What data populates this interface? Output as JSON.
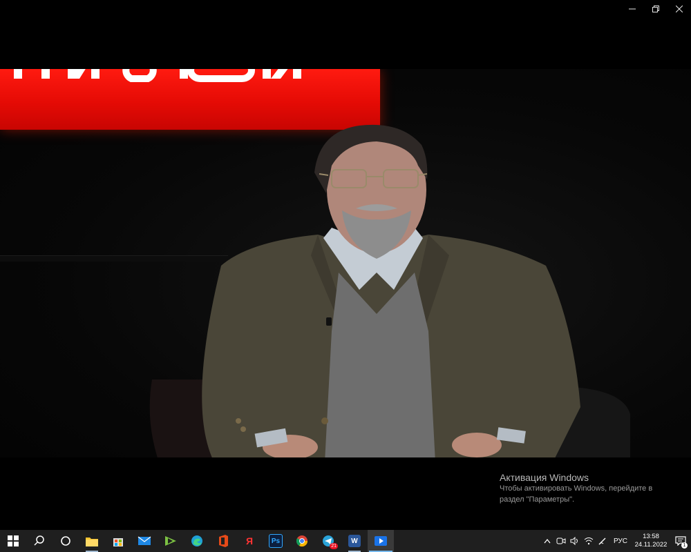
{
  "window": {
    "minimize_glyph": "—",
    "restore_glyph": "❐",
    "close_glyph": "✕"
  },
  "activation": {
    "title": "Активация Windows",
    "line1": "Чтобы активировать Windows, перейдите в",
    "line2": "раздел \"Параметры\"."
  },
  "taskbar": {
    "apps": [
      {
        "name": "file-explorer",
        "color": "#f4c430",
        "label": ""
      },
      {
        "name": "microsoft-store",
        "color": "#3a7bd5",
        "label": ""
      },
      {
        "name": "mail",
        "color": "#1e88e5",
        "label": ""
      },
      {
        "name": "media-app",
        "color": "#7cc243",
        "label": ""
      },
      {
        "name": "edge",
        "color": "#1fa0d6",
        "label": ""
      },
      {
        "name": "office",
        "color": "#e64a19",
        "label": ""
      },
      {
        "name": "yandex",
        "color": "#e53935",
        "label": "Я"
      },
      {
        "name": "photoshop",
        "color": "#0c1f3f",
        "label": "Ps"
      },
      {
        "name": "chrome",
        "color": "#4285f4",
        "label": ""
      },
      {
        "name": "telegram",
        "color": "#2aa3d8",
        "label": "",
        "badge": "21"
      },
      {
        "name": "word",
        "color": "#2b579a",
        "label": "W"
      },
      {
        "name": "video-player",
        "color": "#1a73e8",
        "label": ""
      }
    ],
    "language": "РУС",
    "time": "13:58",
    "date": "24.11.2022",
    "notification_count": "1"
  }
}
